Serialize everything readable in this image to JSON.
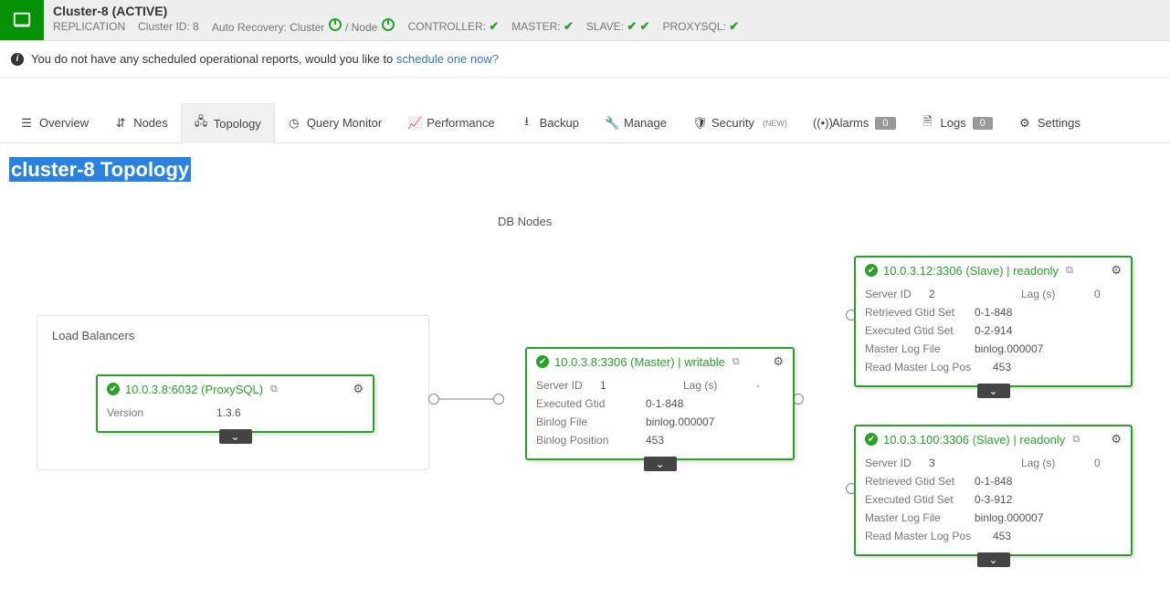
{
  "header": {
    "title": "Cluster-8 (ACTIVE)",
    "replication": "REPLICATION",
    "cluster_id_label": "Cluster ID:",
    "cluster_id": "8",
    "auto_recovery_label": "Auto Recovery:",
    "auto_recovery_cluster": "Cluster",
    "auto_recovery_node": "/ Node",
    "controller_label": "CONTROLLER:",
    "master_label": "MASTER:",
    "slave_label": "SLAVE:",
    "proxysql_label": "PROXYSQL:"
  },
  "banner": {
    "text": "You do not have any scheduled operational reports, would you like to ",
    "link": "schedule one now?"
  },
  "tabs": {
    "overview": "Overview",
    "nodes": "Nodes",
    "topology": "Topology",
    "query_monitor": "Query Monitor",
    "performance": "Performance",
    "backup": "Backup",
    "manage": "Manage",
    "security": "Security",
    "security_new": "(NEW)",
    "alarms": "Alarms",
    "alarms_count": "0",
    "logs": "Logs",
    "logs_count": "0",
    "settings": "Settings"
  },
  "page_title": "cluster-8 Topology",
  "sections": {
    "load_balancers": "Load Balancers",
    "db_nodes": "DB Nodes"
  },
  "nodes": {
    "proxysql": {
      "name": "10.0.3.8:6032 (ProxySQL)",
      "version_label": "Version",
      "version": "1.3.6"
    },
    "master": {
      "name": "10.0.3.8:3306 (Master) | writable",
      "server_id_label": "Server ID",
      "server_id": "1",
      "lag_label": "Lag (s)",
      "lag": "-",
      "exec_gtid_label": "Executed Gtid",
      "exec_gtid": "0-1-848",
      "binlog_file_label": "Binlog File",
      "binlog_file": "binlog.000007",
      "binlog_pos_label": "Binlog Position",
      "binlog_pos": "453"
    },
    "slave1": {
      "name": "10.0.3.12:3306 (Slave) | readonly",
      "server_id_label": "Server ID",
      "server_id": "2",
      "lag_label": "Lag (s)",
      "lag": "0",
      "ret_gtid_label": "Retrieved Gtid Set",
      "ret_gtid": "0-1-848",
      "exec_gtid_label": "Executed Gtid Set",
      "exec_gtid": "0-2-914",
      "mlf_label": "Master Log File",
      "mlf": "binlog.000007",
      "rmlp_label": "Read Master Log Pos",
      "rmlp": "453"
    },
    "slave2": {
      "name": "10.0.3.100:3306 (Slave) | readonly",
      "server_id_label": "Server ID",
      "server_id": "3",
      "lag_label": "Lag (s)",
      "lag": "0",
      "ret_gtid_label": "Retrieved Gtid Set",
      "ret_gtid": "0-1-848",
      "exec_gtid_label": "Executed Gtid Set",
      "exec_gtid": "0-3-912",
      "mlf_label": "Master Log File",
      "mlf": "binlog.000007",
      "rmlp_label": "Read Master Log Pos",
      "rmlp": "453"
    }
  }
}
